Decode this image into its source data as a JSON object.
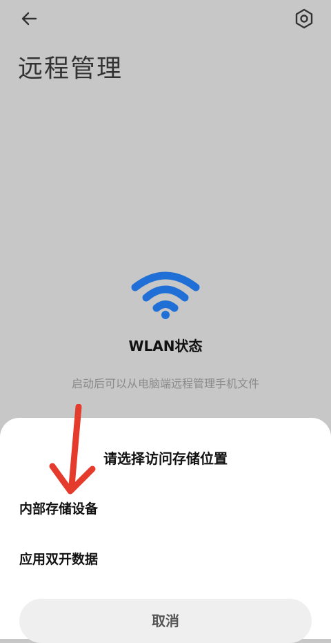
{
  "header": {
    "back_icon": "back-arrow-icon",
    "settings_icon": "settings-hex-icon",
    "title": "远程管理"
  },
  "wlan": {
    "icon": "wifi-icon",
    "status": "WLAN状态",
    "hint": "启动后可以从电脑端远程管理手机文件"
  },
  "sheet": {
    "title": "请选择访问存储位置",
    "options": [
      "内部存储设备",
      "应用双开数据"
    ],
    "cancel_label": "取消"
  },
  "colors": {
    "wifi_blue": "#1f6fd6",
    "annotation_red": "#e53b2c",
    "background_dim": "#c7c7c7"
  }
}
